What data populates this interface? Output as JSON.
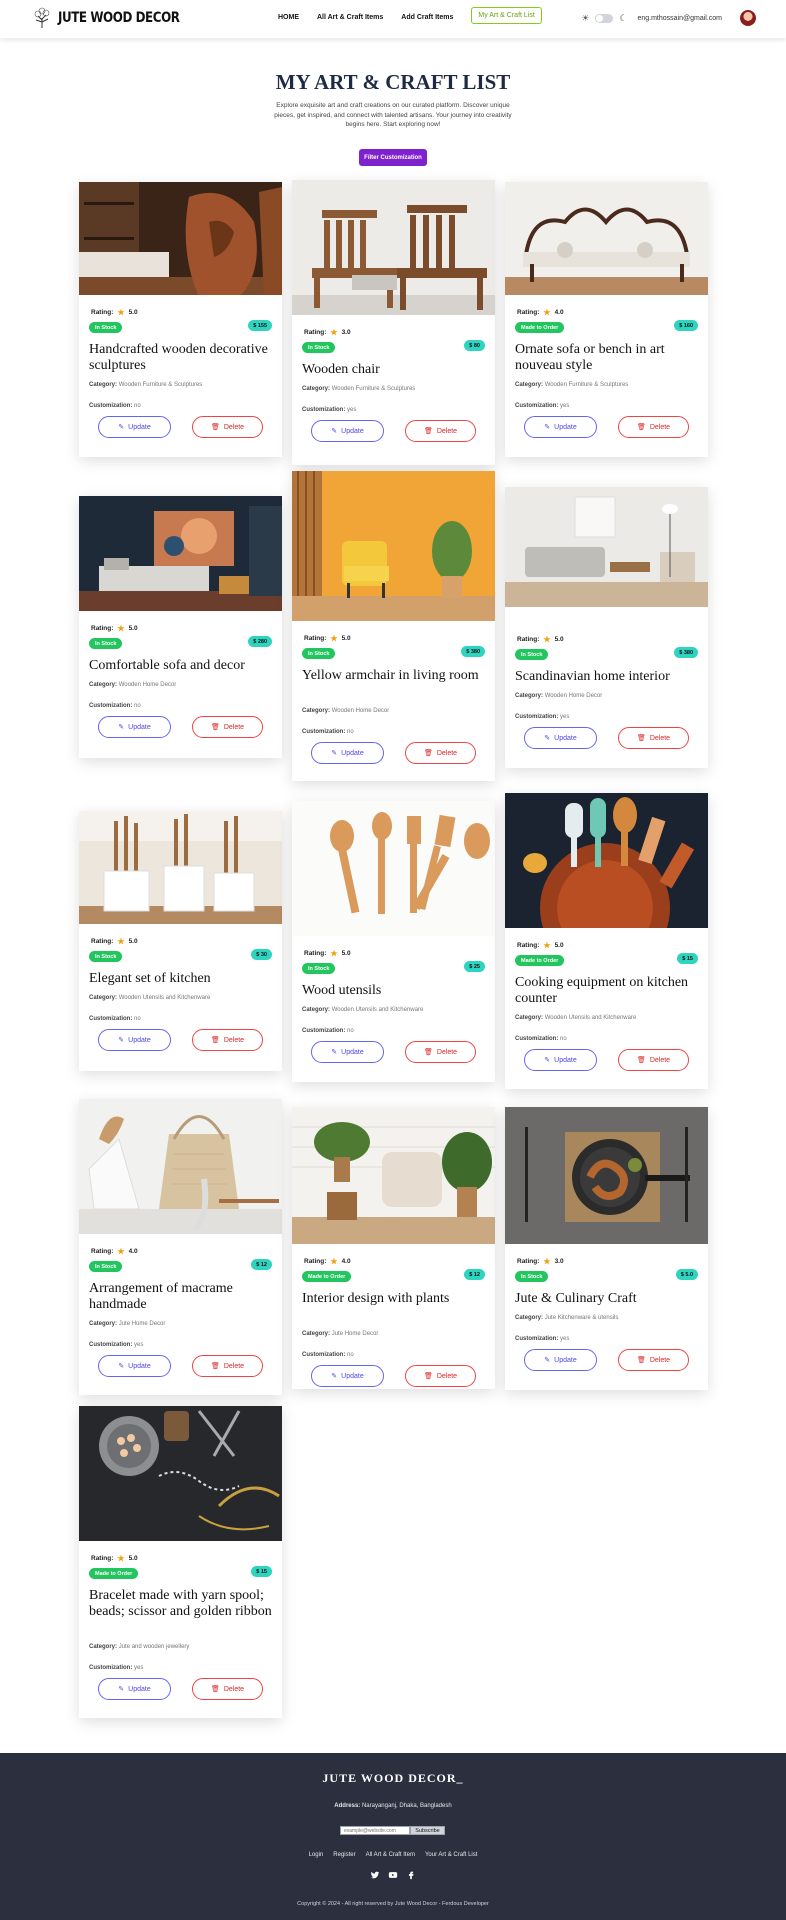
{
  "nav": {
    "brand": "JUTE WOOD DECOR",
    "links": [
      "HOME",
      "All Art & Craft Items",
      "Add Craft Items",
      "My Art & Craft List"
    ],
    "user_email": "eng.mthossain@gmail.com"
  },
  "header": {
    "title": "MY ART & CRAFT LIST",
    "description": "Explore exquisite art and craft creations on our curated platform. Discover unique pieces, get inspired, and connect with talented artisans. Your journey into creativity begins here. Start exploring now!",
    "filter_label": "Filter Customization"
  },
  "labels": {
    "rating": "Rating:",
    "category": "Category:",
    "customization": "Customization:",
    "update": "Update",
    "delete": "Delete"
  },
  "items": [
    {
      "title": "Handcrafted wooden decorative sculptures",
      "rating": "5.0",
      "stock": "In Stock",
      "price": "$ 155",
      "category": "Wooden Furniture & Sculptures",
      "customization": "no",
      "image": "sculpture-photo"
    },
    {
      "title": "Wooden chair",
      "rating": "3.0",
      "stock": "In Stock",
      "price": "$ 80",
      "category": "Wooden Furniture & Sculptures",
      "customization": "yes",
      "image": "chairs-photo"
    },
    {
      "title": "Ornate sofa or bench in art nouveau style",
      "rating": "4.0",
      "stock": "Made to Order",
      "price": "$ 160",
      "category": "Wooden Furniture & Sculptures",
      "customization": "yes",
      "image": "sofa-bench-photo"
    },
    {
      "title": "Comfortable sofa and decor",
      "rating": "5.0",
      "stock": "In Stock",
      "price": "$ 280",
      "category": "Wooden Home Decor",
      "customization": "no",
      "image": "living-room-photo"
    },
    {
      "title": "Yellow armchair in living room",
      "rating": "5.0",
      "stock": "In Stock",
      "price": "$ 380",
      "category": "Wooden Home Decor",
      "customization": "no",
      "image": "yellow-armchair-photo"
    },
    {
      "title": "Scandinavian home interior",
      "rating": "5.0",
      "stock": "In Stock",
      "price": "$ 380",
      "category": "Wooden Home Decor",
      "customization": "yes",
      "image": "scandinavian-photo"
    },
    {
      "title": "Elegant set of kitchen",
      "rating": "5.0",
      "stock": "In Stock",
      "price": "$ 30",
      "category": "Wooden Utensils and Kitchenware",
      "customization": "no",
      "image": "kitchen-utensils-photo"
    },
    {
      "title": "Wood utensils",
      "rating": "5.0",
      "stock": "In Stock",
      "price": "$ 25",
      "category": "Wooden Utensils and Kitchenware",
      "customization": "no",
      "image": "wood-spoons-photo"
    },
    {
      "title": "Cooking equipment on kitchen counter",
      "rating": "5.0",
      "stock": "Made to Order",
      "price": "$ 15",
      "category": "Wooden Utensils and Kitchenware",
      "customization": "no",
      "image": "cooking-equipment-photo"
    },
    {
      "title": "Arrangement of macrame handmade",
      "rating": "4.0",
      "stock": "In Stock",
      "price": "$ 12",
      "category": "Jute Home Decor",
      "customization": "yes",
      "image": "macrame-photo"
    },
    {
      "title": "Interior design with plants",
      "rating": "4.0",
      "stock": "Made to Order",
      "price": "$ 12",
      "category": "Jute Home Decor",
      "customization": "no",
      "image": "plants-interior-photo"
    },
    {
      "title": "Jute & Culinary Craft",
      "rating": "3.0",
      "stock": "In Stock",
      "price": "$ 5.0",
      "category": "Jute Kitchenware & utensils",
      "customization": "yes",
      "image": "sausage-pan-photo"
    },
    {
      "title": "Bracelet made with yarn spool; beads; scissor and golden ribbon",
      "rating": "5.0",
      "stock": "Made to Order",
      "price": "$ 15",
      "category": "Jute and wooden jewellery",
      "customization": "yes",
      "image": "bracelet-photo"
    }
  ],
  "footer": {
    "brand": "JUTE WOOD DECOR_",
    "address_label": "Address:",
    "address": "Narayanganj, Dhaka, Bangladesh",
    "email_placeholder": "example@website.com",
    "subscribe": "Subscribe",
    "links": [
      "Login",
      "Register",
      "All Art & Craft Item",
      "Your Art & Craft List"
    ],
    "social": [
      "twitter-icon",
      "youtube-icon",
      "facebook-icon"
    ],
    "copyright": "Copyright © 2024 - All right reserved by Jute Wood Decor - Ferdous Developer"
  },
  "colors": {
    "accent_purple": "#7e22ce",
    "stock_green": "#22c55e",
    "price_teal": "#2dd4bf",
    "update_blue": "#4f46e5",
    "delete_red": "#dc2626",
    "footer_bg": "#2b2f3e"
  }
}
